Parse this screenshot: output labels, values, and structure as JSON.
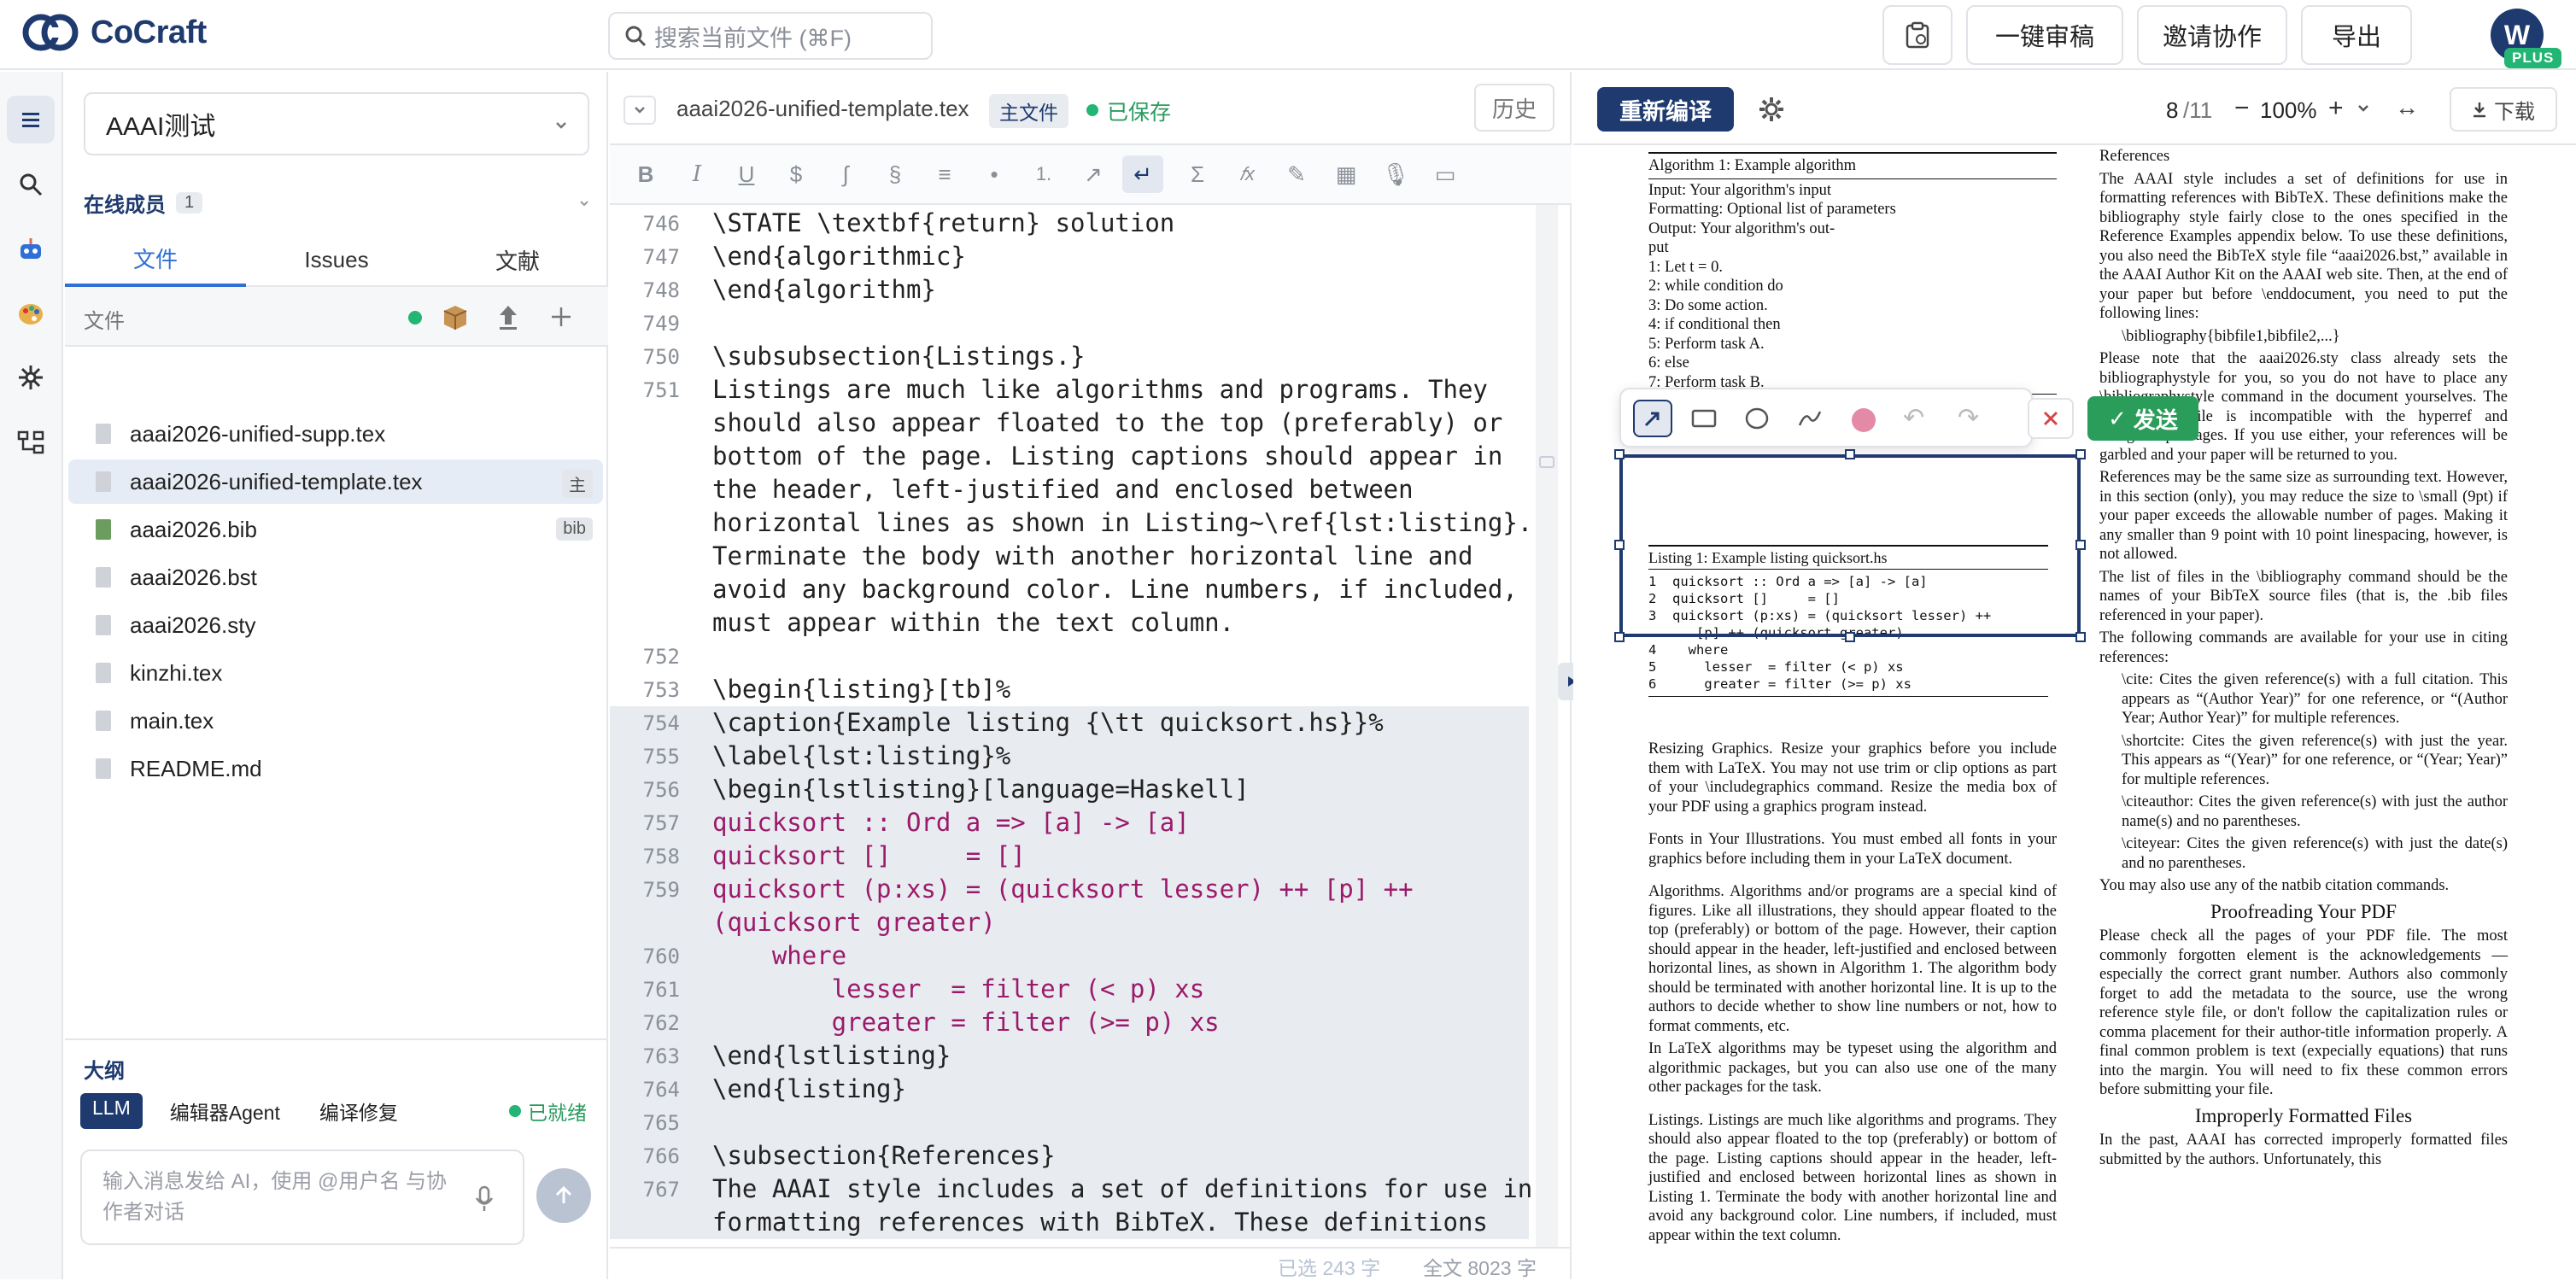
{
  "app": {
    "name": "CoCraft"
  },
  "search": {
    "placeholder": "搜索当前文件 (⌘F)"
  },
  "toolbar": {
    "review": "一键审稿",
    "invite": "邀请协作",
    "export": "导出"
  },
  "user": {
    "initial": "W",
    "plan": "PLUS"
  },
  "project": {
    "name": "AAAI测试"
  },
  "members": {
    "title": "在线成员",
    "count": "1"
  },
  "left_tabs": [
    "文件",
    "Issues",
    "文献"
  ],
  "files": {
    "header": "文件",
    "items": [
      {
        "name": "aaai2026-unified-supp.tex",
        "badge": ""
      },
      {
        "name": "aaai2026-unified-template.tex",
        "badge": "主"
      },
      {
        "name": "aaai2026.bib",
        "badge": "bib"
      },
      {
        "name": "aaai2026.bst",
        "badge": ""
      },
      {
        "name": "aaai2026.sty",
        "badge": ""
      },
      {
        "name": "kinzhi.tex",
        "badge": ""
      },
      {
        "name": "main.tex",
        "badge": ""
      },
      {
        "name": "README.md",
        "badge": ""
      }
    ]
  },
  "outline": {
    "title": "大纲"
  },
  "chat": {
    "tabs": [
      "LLM",
      "编辑器Agent",
      "编译修复"
    ],
    "status": "已就绪",
    "placeholder": "输入消息发给 AI，使用 @用户名 与协作者对话"
  },
  "editor": {
    "filename": "aaai2026-unified-template.tex",
    "main_badge": "主文件",
    "saved": "已保存",
    "history": "历史",
    "selected": "已选 243 字",
    "total": "全文 8023 字",
    "lines": [
      {
        "n": "746",
        "text": "\\STATE \\textbf{return} solution"
      },
      {
        "n": "747",
        "text": "\\end{algorithmic}"
      },
      {
        "n": "748",
        "text": "\\end{algorithm}"
      },
      {
        "n": "749",
        "text": ""
      },
      {
        "n": "750",
        "text": "\\subsubsection{Listings.}"
      },
      {
        "n": "751",
        "text": "Listings are much like algorithms and programs. They"
      },
      {
        "n": "",
        "text": "should also appear floated to the top (preferably) or"
      },
      {
        "n": "",
        "text": "bottom of the page. Listing captions should appear in"
      },
      {
        "n": "",
        "text": "the header, left-justified and enclosed between"
      },
      {
        "n": "",
        "text": "horizontal lines as shown in Listing~\\ref{lst:listing}."
      },
      {
        "n": "",
        "text": "Terminate the body with another horizontal line and"
      },
      {
        "n": "",
        "text": "avoid any background color. Line numbers, if included,"
      },
      {
        "n": "",
        "text": "must appear within the text column."
      },
      {
        "n": "752",
        "text": ""
      },
      {
        "n": "753",
        "text": "\\begin{listing}[tb]%"
      },
      {
        "n": "754",
        "text": "\\caption{Example listing {\\tt quicksort.hs}}%"
      },
      {
        "n": "755",
        "text": "\\label{lst:listing}%"
      },
      {
        "n": "756",
        "text": "\\begin{lstlisting}[language=Haskell]"
      },
      {
        "n": "757",
        "text": "quicksort :: Ord a => [a] -> [a]"
      },
      {
        "n": "758",
        "text": "quicksort []     = []"
      },
      {
        "n": "759",
        "text": "quicksort (p:xs) = (quicksort lesser) ++ [p] ++"
      },
      {
        "n": "",
        "text": "(quicksort greater)"
      },
      {
        "n": "760",
        "text": "    where"
      },
      {
        "n": "761",
        "text": "        lesser  = filter (< p) xs"
      },
      {
        "n": "762",
        "text": "        greater = filter (>= p) xs"
      },
      {
        "n": "763",
        "text": "\\end{lstlisting}"
      },
      {
        "n": "764",
        "text": "\\end{listing}"
      },
      {
        "n": "765",
        "text": ""
      },
      {
        "n": "766",
        "text": "\\subsection{References}"
      },
      {
        "n": "767",
        "text": "The AAAI style includes a set of definitions for use in"
      },
      {
        "n": "",
        "text": "formatting references with BibTeX. These definitions"
      }
    ]
  },
  "pdf": {
    "recompile": "重新编译",
    "page": "8",
    "pages": "/11",
    "zoom": "100%",
    "download": "下载",
    "send": "发送",
    "algo_title": "Algorithm 1: Example algorithm",
    "algo_lines": [
      "Input: Your algorithm's input",
      "Formatting: Optional list of parameters",
      "Output:          Your          algorithm's          out-",
      "put",
      "1:  Let t = 0.",
      "2:  while condition do",
      "3:     Do some action.",
      "4:     if conditional then",
      "5:        Perform task A.",
      "6:     else",
      "7:        Perform task B."
    ],
    "listing_title": "Listing 1: Example listing quicksort.hs",
    "listing_lines": [
      "1  quicksort :: Ord a => [a] -> [a]",
      "2  quicksort []     = []",
      "3  quicksort (p:xs) = (quicksort lesser) ++",
      "      [p] ++ (quicksort greater)",
      "4    where",
      "5      lesser  = filter (< p) xs",
      "6      greater = filter (>= p) xs"
    ],
    "left_paras": [
      "Resizing Graphics.   Resize your graphics before you include them with LaTeX. You may not use trim or clip options as part of your \\includegraphics command. Resize the media box of your PDF using a graphics program instead.",
      "Fonts in Your Illustrations.   You must embed all fonts in your graphics before including them in your LaTeX document.",
      "Algorithms.   Algorithms and/or programs are a special kind of figures. Like all illustrations, they should appear floated to the top (preferably) or bottom of the page. However, their caption should appear in the header, left-justified and enclosed between horizontal lines, as shown in Algorithm 1. The algorithm body should be terminated with another horizontal line. It is up to the authors to decide whether to show line numbers or not, how to format comments, etc.",
      "In LaTeX algorithms may be typeset using the algorithm and algorithmic packages, but you can also use one of the many other packages for the task.",
      "Listings.   Listings are much like algorithms and programs. They should also appear floated to the top (preferably) or bottom of the page. Listing captions should appear in the header, left-justified and enclosed between horizontal lines as shown in Listing 1. Terminate the body with another horizontal line and avoid any background color. Line numbers, if included, must appear within the text column."
    ],
    "right_heading": "References",
    "right_paras": [
      "The AAAI style includes a set of definitions for use in formatting references with BibTeX. These definitions make the bibliography style fairly close to the ones specified in the Reference Examples appendix below. To use these definitions, you also need the BibTeX style file “aaai2026.bst,” available in the AAAI Author Kit on the AAAI web site. Then, at the end of your paper but before \\enddocument, you need to put the following lines:",
      "\\bibliography{bibfile1,bibfile2,...}",
      "Please note that the aaai2026.sty class already sets the bibliographystyle for you, so you do not have to place any \\bibliographystyle command in the document yourselves. The aaai2026.sty file is incompatible with the hyperref and navigator packages. If you use either, your references will be garbled and your paper will be returned to you.",
      "References may be the same size as surrounding text. However, in this section (only), you may reduce the size to \\small (9pt) if your paper exceeds the allowable number of pages. Making it any smaller than 9 point with 10 point linespacing, however, is not allowed.",
      "The list of files in the \\bibliography command should be the names of your BibTeX source files (that is, the .bib files referenced in your paper).",
      "The following commands are available for your use in citing references:",
      "\\cite: Cites the given reference(s) with a full citation. This appears as “(Author Year)” for one reference, or “(Author Year; Author Year)” for multiple references.",
      "\\shortcite: Cites the given reference(s) with just the year. This appears as “(Year)” for one reference, or “(Year; Year)” for multiple references.",
      "\\citeauthor: Cites the given reference(s) with just the author name(s) and no parentheses.",
      "\\citeyear: Cites the given reference(s) with just the date(s) and no parentheses.",
      "You may also use any of the natbib citation commands."
    ],
    "proof_heading": "Proofreading Your PDF",
    "proof_para": "Please check all the pages of your PDF file. The most commonly forgotten element is the acknowledgements — especially the correct grant number. Authors also commonly forget to add the metadata to the source, use the wrong reference style file, or don't follow the capitalization rules or comma placement for their author-title information properly. A final common problem is text (expecially equations) that runs into the margin. You will need to fix these common errors before submitting your file.",
    "improper_heading": "Improperly Formatted Files",
    "improper_para": "In the past, AAAI has corrected improperly formatted files submitted by the authors. Unfortunately, this"
  },
  "colors": {
    "brand": "#1e3a6e",
    "accent": "#2f6fd6",
    "green": "#22b573"
  }
}
